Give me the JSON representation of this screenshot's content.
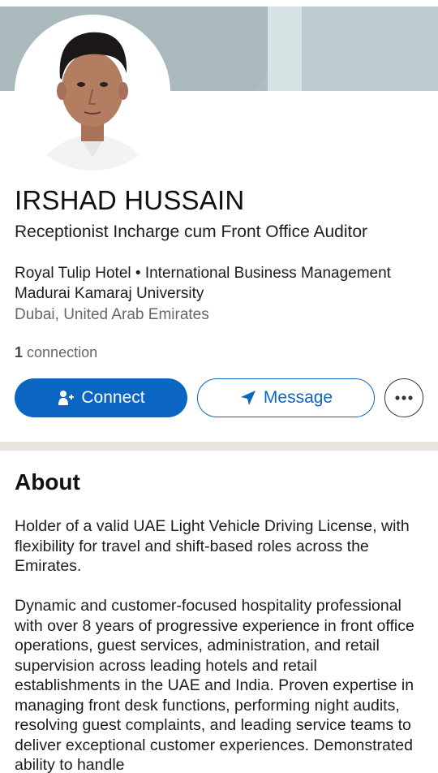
{
  "profile": {
    "name": "IRSHAD HUSSAIN",
    "headline": "Receptionist Incharge cum Front Office Auditor",
    "education": "Royal Tulip Hotel • International Business Management Madurai Kamaraj University",
    "location": "Dubai, United Arab Emirates",
    "connections_count": "1",
    "connections_label": "connection"
  },
  "actions": {
    "connect_label": "Connect",
    "message_label": "Message",
    "more_icon": "more-horizontal-icon"
  },
  "about": {
    "title": "About",
    "paragraph_1": "Holder of a valid UAE Light Vehicle Driving License, with flexibility for travel and shift-based roles across the Emirates.",
    "paragraph_2": "Dynamic and customer-focused hospitality professional with over 8 years of progressive experience in front office operations, guest services, administration, and retail supervision across leading hotels and retail establishments in the UAE and India. Proven expertise in managing front desk functions, performing night audits, resolving guest complaints, and leading service teams to deliver exceptional customer experiences. Demonstrated ability to handle"
  },
  "colors": {
    "primary": "#0a66c2",
    "divider": "#e9e5df",
    "banner": "#aebdc0"
  }
}
